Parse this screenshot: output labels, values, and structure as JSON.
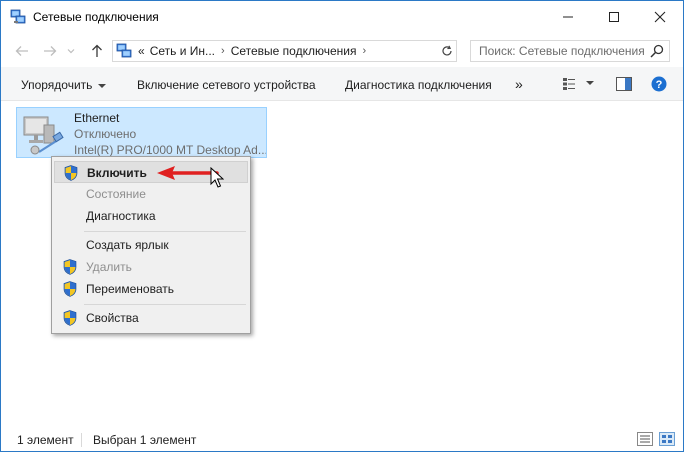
{
  "window": {
    "title": "Сетевые подключения",
    "controls": [
      "minimize",
      "maximize",
      "close"
    ]
  },
  "nav": {
    "back_icon": "arrow-left-icon",
    "forward_icon": "arrow-right-icon",
    "recent_icon": "chevron-down-icon",
    "up_icon": "arrow-up-icon",
    "address": {
      "overflow": "«",
      "crumbs": [
        "Сеть и Ин...",
        "Сетевые подключения"
      ]
    },
    "search_placeholder": "Поиск: Сетевые подключения"
  },
  "commands": {
    "organize": "Упорядочить",
    "enable_device": "Включение сетевого устройства",
    "diagnose": "Диагностика подключения",
    "more": "»"
  },
  "connection": {
    "name": "Ethernet",
    "status": "Отключено",
    "adapter": "Intel(R) PRO/1000 MT Desktop Ad..."
  },
  "context_menu": {
    "items": [
      {
        "label": "Включить",
        "shield": true,
        "bold": true,
        "disabled": false
      },
      {
        "label": "Состояние",
        "shield": false,
        "bold": false,
        "disabled": true
      },
      {
        "label": "Диагностика",
        "shield": false,
        "bold": false,
        "disabled": false
      },
      {
        "label": "Создать ярлык",
        "shield": false,
        "bold": false,
        "disabled": false
      },
      {
        "label": "Удалить",
        "shield": true,
        "bold": false,
        "disabled": true
      },
      {
        "label": "Переименовать",
        "shield": true,
        "bold": false,
        "disabled": false
      },
      {
        "label": "Свойства",
        "shield": true,
        "bold": false,
        "disabled": false
      }
    ]
  },
  "status": {
    "count": "1 элемент",
    "selected": "Выбран 1 элемент"
  },
  "colors": {
    "selection_bg": "#cce8ff",
    "selection_border": "#99d1ff",
    "window_border": "#2b79c6",
    "arrow_red": "#e02020",
    "help_blue": "#1c6fd1"
  }
}
